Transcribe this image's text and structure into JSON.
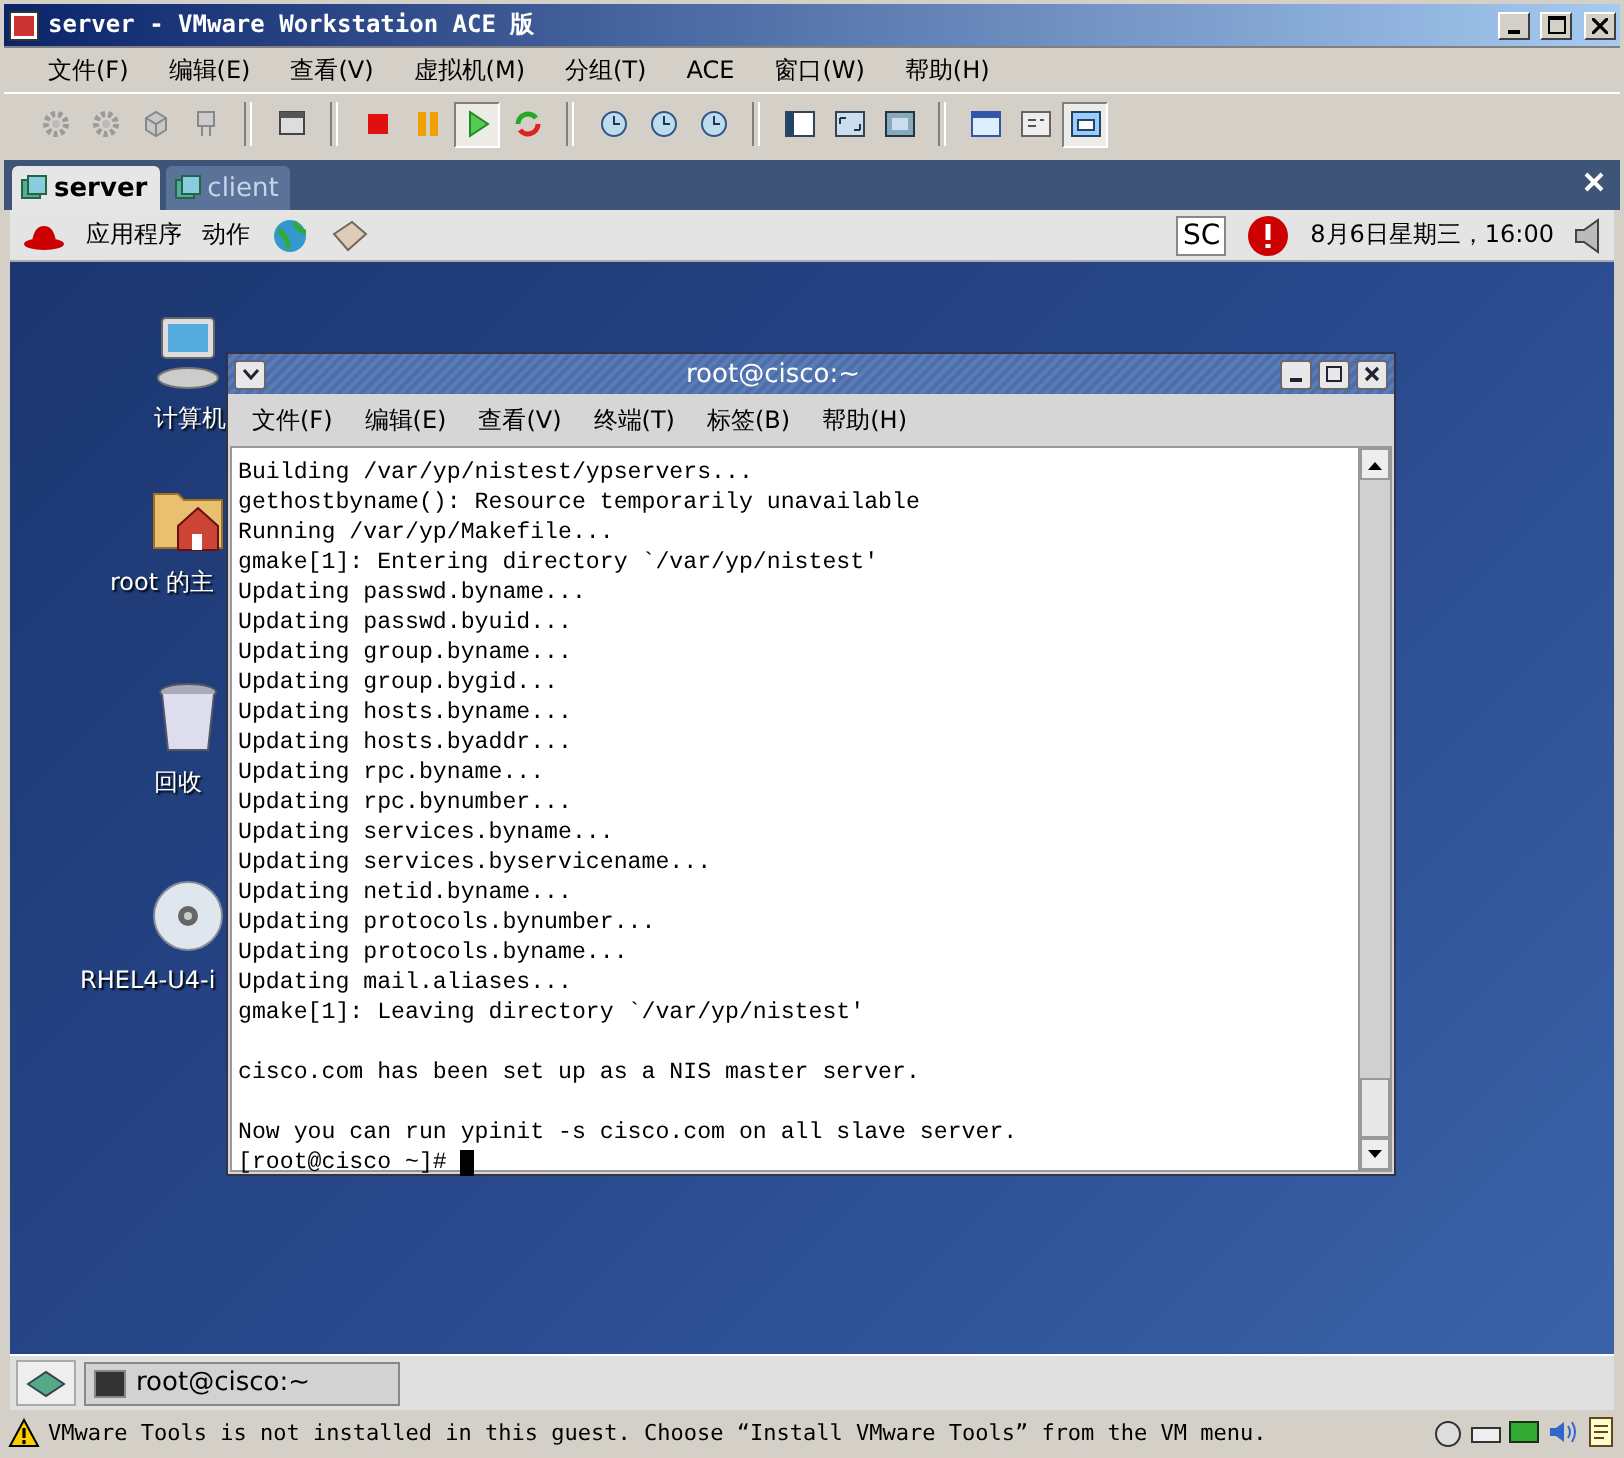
{
  "window": {
    "title": "server - VMware Workstation ACE 版"
  },
  "menu": [
    "文件(F)",
    "编辑(E)",
    "查看(V)",
    "虚拟机(M)",
    "分组(T)",
    "ACE",
    "窗口(W)",
    "帮助(H)"
  ],
  "toolbar": [
    [
      {
        "kind": "gear",
        "pressed": false
      },
      {
        "kind": "gear",
        "pressed": false
      },
      {
        "kind": "cube",
        "pressed": false
      },
      {
        "kind": "plug",
        "pressed": false
      }
    ],
    [
      {
        "kind": "window",
        "pressed": false
      }
    ],
    [
      {
        "kind": "stop",
        "pressed": false
      },
      {
        "kind": "pause",
        "pressed": false
      },
      {
        "kind": "play",
        "pressed": true
      },
      {
        "kind": "reset",
        "pressed": false
      }
    ],
    [
      {
        "kind": "clock",
        "pressed": false
      },
      {
        "kind": "clock",
        "pressed": false
      },
      {
        "kind": "clock",
        "pressed": false
      }
    ],
    [
      {
        "kind": "sidebar",
        "pressed": false
      },
      {
        "kind": "fit",
        "pressed": false
      },
      {
        "kind": "fullscreen",
        "pressed": false
      }
    ],
    [
      {
        "kind": "console",
        "pressed": false
      },
      {
        "kind": "summary",
        "pressed": false
      },
      {
        "kind": "switch",
        "pressed": true
      }
    ]
  ],
  "tabs": [
    {
      "label": "server",
      "selected": true
    },
    {
      "label": "client",
      "selected": false
    }
  ],
  "guest": {
    "panel": {
      "menus": [
        "应用程序",
        "动作"
      ],
      "keyboard": "SC",
      "clock": "8月6日星期三，16:00"
    },
    "desktop_icons": [
      {
        "kind": "computer",
        "label": "计算机"
      },
      {
        "kind": "home",
        "label": "root 的主"
      },
      {
        "kind": "trash",
        "label": "回收"
      },
      {
        "kind": "disc",
        "label": "RHEL4-U4-i"
      }
    ],
    "terminal": {
      "title": "root@cisco:~",
      "menu": [
        "文件(F)",
        "编辑(E)",
        "查看(V)",
        "终端(T)",
        "标签(B)",
        "帮助(H)"
      ],
      "blocks": [
        [
          "Building /var/yp/nistest/ypservers...",
          "gethostbyname(): Resource temporarily unavailable",
          "Running /var/yp/Makefile...",
          "gmake[1]: Entering directory `/var/yp/nistest'",
          "Updating passwd.byname...",
          "Updating passwd.byuid...",
          "Updating group.byname...",
          "Updating group.bygid...",
          "Updating hosts.byname...",
          "Updating hosts.byaddr...",
          "Updating rpc.byname...",
          "Updating rpc.bynumber...",
          "Updating services.byname...",
          "Updating services.byservicename...",
          "Updating netid.byname...",
          "Updating protocols.bynumber...",
          "Updating protocols.byname...",
          "Updating mail.aliases...",
          "gmake[1]: Leaving directory `/var/yp/nistest'"
        ],
        [
          "cisco.com has been set up as a NIS master server."
        ],
        [
          "Now you can run ypinit -s cisco.com on all slave server."
        ]
      ],
      "prompt": "[root@cisco ~]#"
    },
    "taskbar": [
      {
        "label": "root@cisco:~"
      }
    ]
  },
  "status_bar": {
    "message": "VMware Tools is not installed in this guest. Choose “Install VMware Tools” from the VM menu."
  }
}
